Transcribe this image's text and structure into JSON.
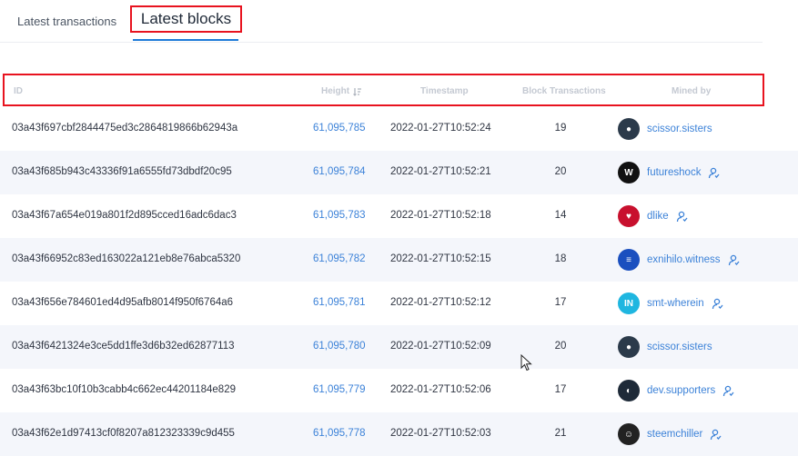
{
  "tabs": {
    "transactions_label": "Latest transactions",
    "blocks_label": "Latest blocks"
  },
  "table": {
    "headers": {
      "id": "ID",
      "height": "Height",
      "timestamp": "Timestamp",
      "block_transactions": "Block Transactions",
      "mined_by": "Mined by"
    },
    "rows": [
      {
        "id": "03a43f697cbf2844475ed3c2864819866b62943a",
        "height": "61,095,785",
        "timestamp": "2022-01-27T10:52:24",
        "tx": "19",
        "miner": "scissor.sisters",
        "avatar_color": "#2b3a4a",
        "avatar_icon": "photo-avatar",
        "witness": false
      },
      {
        "id": "03a43f685b943c43336f91a6555fd73dbdf20c95",
        "height": "61,095,784",
        "timestamp": "2022-01-27T10:52:21",
        "tx": "20",
        "miner": "futureshock",
        "avatar_color": "#111111",
        "avatar_icon": "w-logo",
        "witness": true
      },
      {
        "id": "03a43f67a654e019a801f2d895cced16adc6dac3",
        "height": "61,095,783",
        "timestamp": "2022-01-27T10:52:18",
        "tx": "14",
        "miner": "dlike",
        "avatar_color": "#c8102e",
        "avatar_icon": "heart-logo",
        "witness": true
      },
      {
        "id": "03a43f66952c83ed163022a121eb8e76abca5320",
        "height": "61,095,782",
        "timestamp": "2022-01-27T10:52:15",
        "tx": "18",
        "miner": "exnihilo.witness",
        "avatar_color": "#1a4fbf",
        "avatar_icon": "steem-logo",
        "witness": true
      },
      {
        "id": "03a43f656e784601ed4d95afb8014f950f6764a6",
        "height": "61,095,781",
        "timestamp": "2022-01-27T10:52:12",
        "tx": "17",
        "miner": "smt-wherein",
        "avatar_color": "#1fb6e0",
        "avatar_icon": "in-logo",
        "witness": true
      },
      {
        "id": "03a43f6421324e3ce5dd1ffe3d6b32ed62877113",
        "height": "61,095,780",
        "timestamp": "2022-01-27T10:52:09",
        "tx": "20",
        "miner": "scissor.sisters",
        "avatar_color": "#2b3a4a",
        "avatar_icon": "photo-avatar",
        "witness": false
      },
      {
        "id": "03a43f63bc10f10b3cabb4c662ec44201184e829",
        "height": "61,095,779",
        "timestamp": "2022-01-27T10:52:06",
        "tx": "17",
        "miner": "dev.supporters",
        "avatar_color": "#1e2a38",
        "avatar_icon": "moon-logo",
        "witness": true
      },
      {
        "id": "03a43f62e1d97413cf0f8207a812323339c9d455",
        "height": "61,095,778",
        "timestamp": "2022-01-27T10:52:03",
        "tx": "21",
        "miner": "steemchiller",
        "avatar_color": "#222222",
        "avatar_icon": "face-avatar",
        "witness": true
      }
    ]
  },
  "colors": {
    "link": "#3c82d8",
    "highlight_border": "#e8131f",
    "active_tab_underline": "#1d7bd8",
    "row_stripe": "#f4f6fb"
  }
}
